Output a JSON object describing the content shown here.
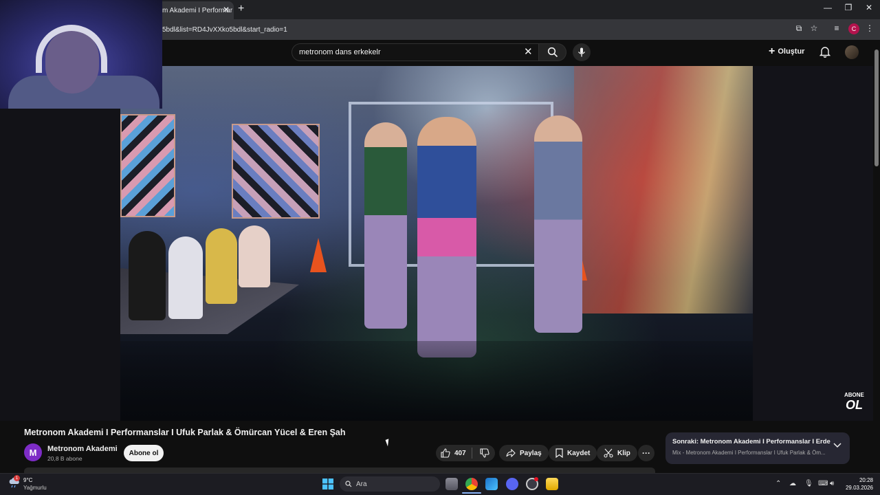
{
  "browser": {
    "tab_title": "m Akademi I Performar",
    "url": "5bdl&list=RD4JvXXko5bdl&start_radio=1",
    "profile_initial": "C"
  },
  "youtube": {
    "search_query": "metronom dans erkekelr",
    "create_label": "Oluştur"
  },
  "video": {
    "title": "Metronom Akademi I Performanslar I Ufuk Parlak & Ömürcan Yücel & Eren Şah",
    "watermark_line1": "ABONE",
    "watermark_line2": "OL"
  },
  "channel": {
    "avatar_letter": "M",
    "name": "Metronom Akademi",
    "subscribers": "20,8 B abone",
    "subscribe_label": "Abone ol"
  },
  "actions": {
    "like_count": "407",
    "share_label": "Paylaş",
    "save_label": "Kaydet",
    "clip_label": "Klip"
  },
  "up_next": {
    "title": "Sonraki: Metronom Akademi I Performanslar I Erde...",
    "subtitle": "Mix - Metronom Akademi I Performanslar I Ufuk Parlak & Öm..."
  },
  "taskbar": {
    "weather_temp": "9°C",
    "weather_desc": "Yağmurlu",
    "weather_badge": "1",
    "search_placeholder": "Ara",
    "time": "20:28",
    "date": "29.03.2026"
  },
  "colors": {
    "youtube_bg": "#0f0f0f",
    "channel_avatar": "#7d2cc6",
    "pill_bg": "#272727"
  }
}
